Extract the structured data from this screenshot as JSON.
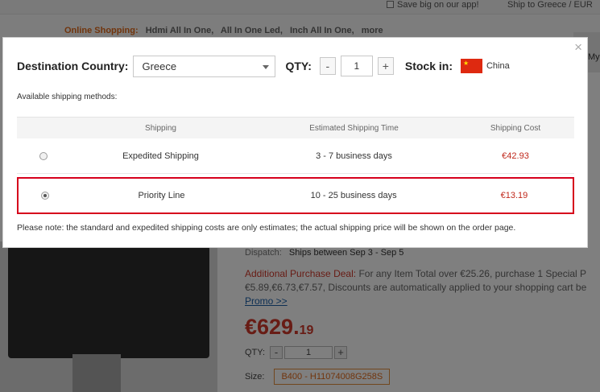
{
  "background": {
    "topbar": {
      "app_text": "Save big on our app!",
      "ship_text": "Ship to Greece / EUR"
    },
    "search_tags": {
      "lead": "Online Shopping:",
      "tags": [
        "Hdmi All In One,",
        "All In One Led,",
        "Inch All In One,",
        "more"
      ]
    },
    "right_bar_text": "My",
    "dispatch": {
      "label": "Dispatch:",
      "value": "Ships between Sep 3 - Sep 5"
    },
    "deal": {
      "label": "Additional Purchase Deal:",
      "line1": "For any Item Total over €25.26, purchase 1 Special P",
      "line2": "€5.89,€6.73,€7.57, Discounts are automatically applied to your shopping cart be"
    },
    "promo_link": "Promo >>",
    "price": {
      "main": "€629.",
      "cents": "19"
    },
    "qty": {
      "label": "QTY:",
      "minus": "-",
      "value": "1",
      "plus": "+"
    },
    "size": {
      "label": "Size:",
      "value": "B400 - H11074008G258S"
    }
  },
  "modal": {
    "close": "×",
    "destination_label": "Destination Country:",
    "destination_value": "Greece",
    "qty_label": "QTY:",
    "qty_minus": "-",
    "qty_value": "1",
    "qty_plus": "+",
    "stock_label": "Stock in:",
    "stock_country": "China",
    "available_methods_label": "Available shipping methods:",
    "table": {
      "headers": [
        "Shipping",
        "Estimated Shipping Time",
        "Shipping Cost"
      ],
      "rows": [
        {
          "method": "Expedited Shipping",
          "time": "3 - 7 business days",
          "cost": "€42.93",
          "selected": false
        },
        {
          "method": "Priority Line",
          "time": "10 - 25 business days",
          "cost": "€13.19",
          "selected": true
        }
      ]
    },
    "note": "Please note: the standard and expedited shipping costs are only estimates; the actual shipping price will be shown on the order page."
  }
}
